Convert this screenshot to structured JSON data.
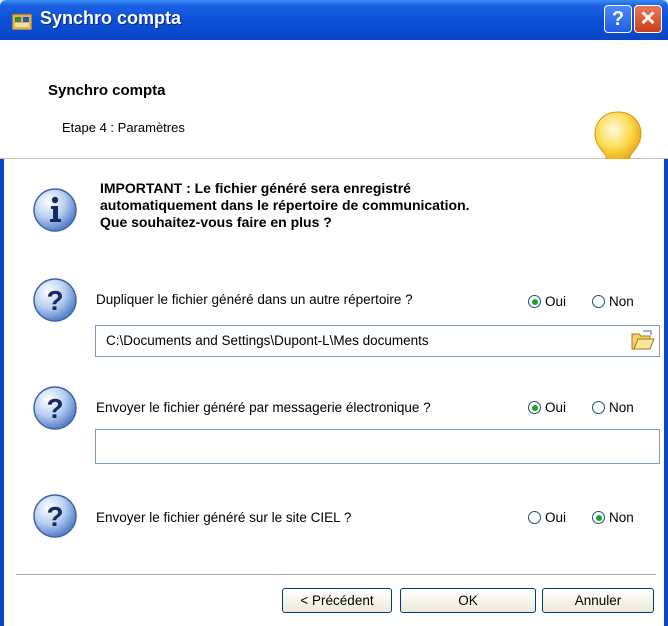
{
  "window": {
    "title": "Synchro compta",
    "help_label": "?",
    "close_label": "✕"
  },
  "header": {
    "title": "Synchro compta",
    "subtitle": "Etape 4 : Paramètres",
    "icon": "lightbulb-icon"
  },
  "info": {
    "icon": "info-icon",
    "lines": [
      "IMPORTANT : Le fichier généré sera enregistré",
      "automatiquement dans le répertoire de communication.",
      "Que souhaitez-vous faire en plus ?"
    ]
  },
  "questions": [
    {
      "label": "Dupliquer le fichier généré dans un autre répertoire ?",
      "oui": "Oui",
      "non": "Non",
      "selected": "oui"
    },
    {
      "label": "Envoyer le fichier généré par messagerie électronique ?",
      "oui": "Oui",
      "non": "Non",
      "selected": "oui"
    },
    {
      "label": "Envoyer le fichier généré sur le site CIEL ?",
      "oui": "Oui",
      "non": "Non",
      "selected": "non"
    }
  ],
  "path_field": {
    "value": "C:\\Documents and Settings\\Dupont-L\\Mes documents",
    "browse_icon": "folder-open-icon"
  },
  "email_field": {
    "value": ""
  },
  "buttons": {
    "previous": "< Précédent",
    "ok": "OK",
    "cancel": "Annuler"
  },
  "colors": {
    "titlebar": "#0a46c4",
    "radio_selected": "#21a121",
    "window_bg": "#ece9d8"
  }
}
